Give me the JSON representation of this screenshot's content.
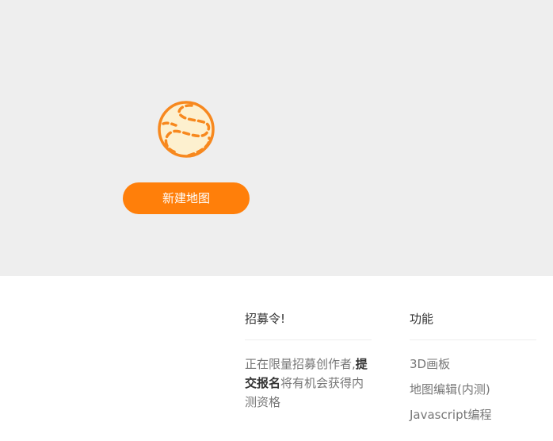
{
  "hero": {
    "logo_icon": "orange-map-path-logo",
    "new_map_button": "新建地图",
    "accent_color": "#ff7f0a"
  },
  "recruit": {
    "title": "招募令!",
    "text_before": "正在限量招募创作者,",
    "text_bold": "提交报名",
    "text_after": "将有机会获得内测资格"
  },
  "features": {
    "title": "功能",
    "items": [
      "3D画板",
      "地图编辑(内测)",
      "Javascript编程"
    ]
  }
}
